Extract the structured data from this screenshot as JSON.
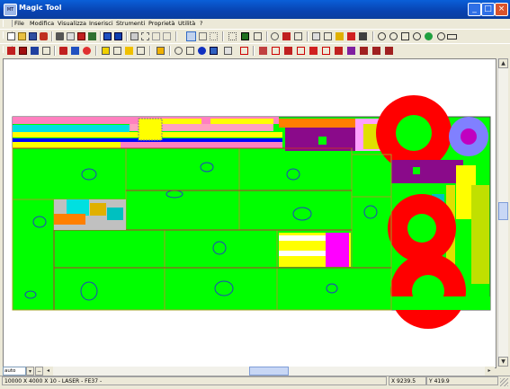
{
  "window": {
    "title": "Magic Tool",
    "icon": "app-icon",
    "icon_text": "MT"
  },
  "menu": [
    "File",
    "Modifica",
    "Visualizza",
    "Inserisci",
    "Strumenti",
    "Proprietà",
    "Utilità",
    "?"
  ],
  "toolbar_icons": {
    "row1": [
      "new-icon",
      "open-icon",
      "save-icon",
      "print-icon",
      "cut-icon",
      "copy-icon",
      "paste-icon",
      "layers-icon",
      "sheet-icon",
      "zoom-icon",
      "zoom-in-icon",
      "zoom-out-icon",
      "pan-icon",
      "refresh-icon",
      "grid-icon"
    ],
    "row2": [
      "part-icon",
      "nest-icon",
      "move-icon",
      "rotate-icon",
      "mirror-icon",
      "info-icon",
      "measure-icon",
      "cut-path-icon",
      "tool-icon",
      "laser-icon"
    ]
  },
  "drawing": {
    "description_colors": {
      "sheet": "#00ff00",
      "red": "#ff0000",
      "purple": "#8a0a8a",
      "blue": "#0000ff",
      "yellow": "#ffff00",
      "orange": "#ff7f00",
      "cyan": "#00e0e0",
      "magenta": "#ff00ff",
      "pink": "#ff80c0"
    }
  },
  "zoom_select": {
    "value": "auto"
  },
  "status": {
    "sheet_info": "10000 X 4000 X 10 - LASER - FE37 -",
    "x_coord": "X 9239.5",
    "y_coord": "Y 419.9"
  },
  "colors": {
    "titlebar": "#0842b0",
    "face": "#ece9d8"
  }
}
